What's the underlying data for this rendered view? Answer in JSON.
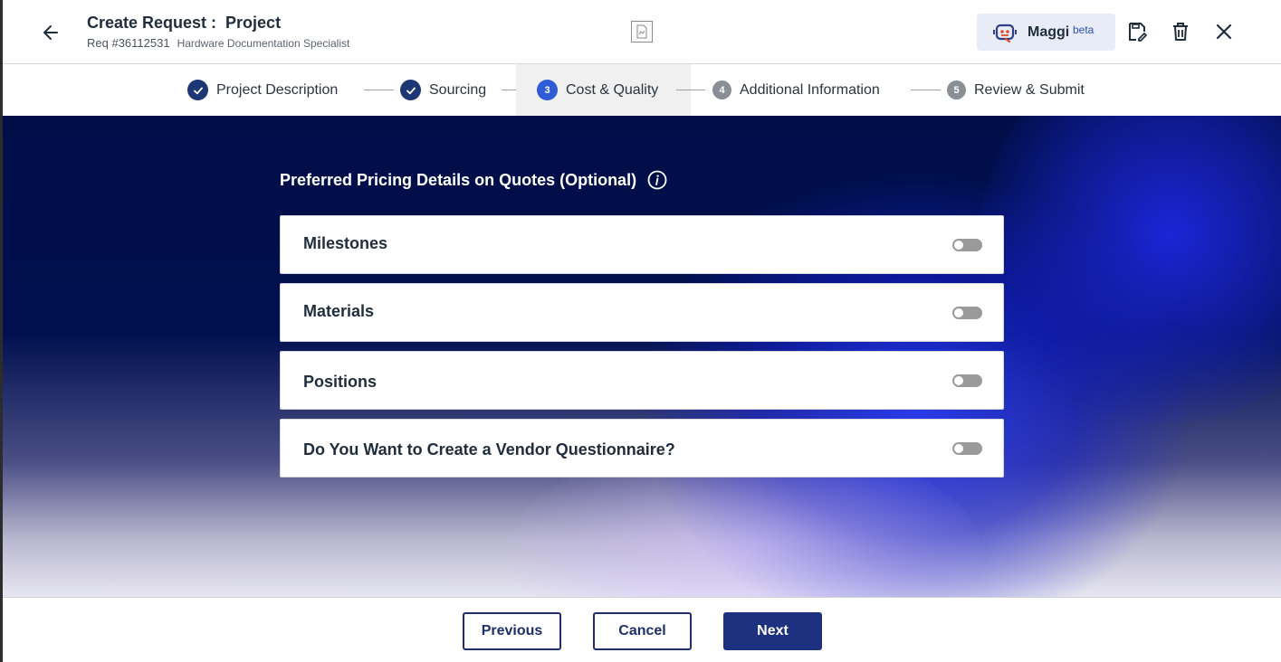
{
  "header": {
    "title": "Create Request :  Project",
    "req_number": "Req #36112531",
    "req_subtitle": "Hardware Documentation Specialist",
    "assistant_label": "Maggi",
    "assistant_badge": "beta",
    "icons": {
      "back": "arrow-left-icon",
      "document": "document-thumbnail-icon",
      "assistant": "robot-icon",
      "save": "save-draft-icon",
      "delete": "trash-icon",
      "close": "close-icon"
    }
  },
  "stepper": {
    "steps": [
      {
        "number": "1",
        "label": "Project Description",
        "status": "completed"
      },
      {
        "number": "2",
        "label": "Sourcing",
        "status": "completed"
      },
      {
        "number": "3",
        "label": "Cost & Quality",
        "status": "current"
      },
      {
        "number": "4",
        "label": "Additional Information",
        "status": "upcoming"
      },
      {
        "number": "5",
        "label": "Review & Submit",
        "status": "upcoming"
      }
    ]
  },
  "main": {
    "heading": "Preferred Pricing Details on Quotes (Optional)",
    "options": [
      {
        "label": "Milestones",
        "enabled": false
      },
      {
        "label": "Materials",
        "enabled": false
      },
      {
        "label": "Positions",
        "enabled": false
      },
      {
        "label": "Do You Want to Create a Vendor Questionnaire?",
        "enabled": false
      }
    ]
  },
  "footer": {
    "previous_label": "Previous",
    "cancel_label": "Cancel",
    "next_label": "Next"
  },
  "colors": {
    "primary": "#1e3080",
    "step_done": "#1e3673",
    "step_current": "#2f5bd7",
    "step_upcoming": "#8a8f96",
    "toggle_off": "#9a9a9a",
    "hero_dark": "#000e48"
  }
}
